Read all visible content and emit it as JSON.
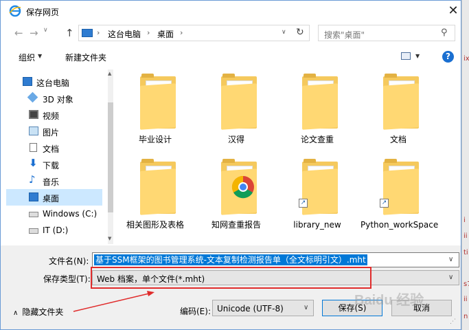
{
  "window": {
    "title": "保存网页",
    "close_glyph": "✕"
  },
  "nav": {
    "back_glyph": "←",
    "forward_glyph": "→",
    "dropdown_glyph": "∨",
    "up_glyph": "↑",
    "address": {
      "sep1": "›",
      "crumb1": "这台电脑",
      "sep2": "›",
      "crumb2": "桌面",
      "sep3": "›",
      "refresh_glyph": "↻",
      "dropdown_glyph": "∨"
    },
    "search": {
      "placeholder": "搜索\"桌面\"",
      "icon_glyph": "⚲"
    }
  },
  "toolbar": {
    "organize": "组织",
    "organize_dd": "▼",
    "new_folder": "新建文件夹",
    "view_dd": "▼",
    "help": "?"
  },
  "sidebar": {
    "items": [
      {
        "label": "这台电脑",
        "icon": "computer-icon"
      },
      {
        "label": "3D 对象",
        "icon": "3d-objects-icon"
      },
      {
        "label": "视频",
        "icon": "video-icon"
      },
      {
        "label": "图片",
        "icon": "pictures-icon"
      },
      {
        "label": "文档",
        "icon": "documents-icon"
      },
      {
        "label": "下载",
        "icon": "download-icon"
      },
      {
        "label": "音乐",
        "icon": "music-icon"
      },
      {
        "label": "桌面",
        "icon": "desktop-icon"
      },
      {
        "label": "Windows  (C:)",
        "icon": "drive-icon"
      },
      {
        "label": "IT (D:)",
        "icon": "drive-icon"
      }
    ],
    "selected_index": 7,
    "scroll_up": "▲",
    "scroll_down": "▼"
  },
  "files": {
    "items": [
      {
        "label": "毕业设计",
        "shortcut": false
      },
      {
        "label": "汉得",
        "shortcut": false
      },
      {
        "label": "论文查重",
        "shortcut": false
      },
      {
        "label": "文档",
        "shortcut": false
      },
      {
        "label": "相关图形及表格",
        "shortcut": false
      },
      {
        "label": "知网查重报告",
        "shortcut": false
      },
      {
        "label": "library_new",
        "shortcut": true
      },
      {
        "label": "Python_workSpace",
        "shortcut": true
      }
    ],
    "shortcut_glyph": "↗",
    "scroll_up": "▲",
    "scroll_down": "▼"
  },
  "form": {
    "filename_label": "文件名(N):",
    "filename_value": "基于SSM框架的图书管理系统-文本复制检测报告单（全文标明引文）.mht",
    "filetype_label": "保存类型(T):",
    "filetype_value": "Web 档案，单个文件(*.mht)",
    "dropdown_glyph": "∨",
    "hide_folders": "隐藏文件夹",
    "hide_caret": "∧",
    "encoding_label": "编码(E):",
    "encoding_value": "Unicode (UTF-8)",
    "save_button": "保存(S)",
    "cancel_button": "取消",
    "resize_grip": "⋰"
  },
  "overlay": {
    "watermark": "Baidu 经验",
    "background_fragments": [
      "ix",
      "i",
      "ii",
      "ti",
      "s7",
      "ii",
      "n"
    ]
  },
  "colors": {
    "accent": "#0078d7",
    "selection": "#cce8ff",
    "annotation": "#e02b2b",
    "folder": "#f5c95d"
  }
}
